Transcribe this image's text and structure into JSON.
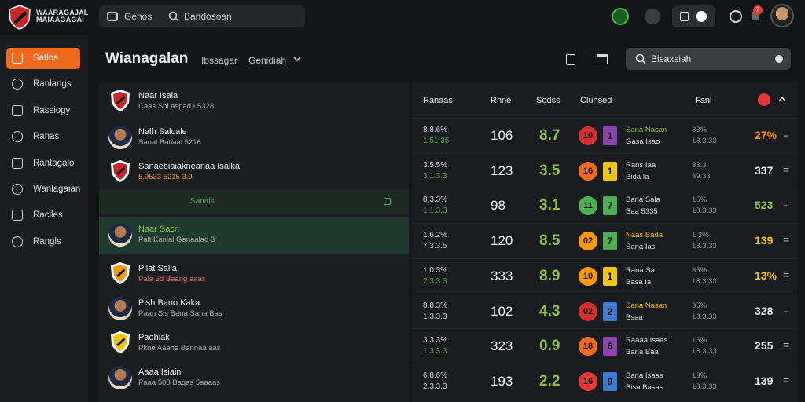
{
  "topbar": {
    "brand_line1": "WAARAGAJAL",
    "brand_line2": "MAIAAGAGAI",
    "search_tab": "Genos",
    "search_placeholder": "Bandosoan",
    "notification_count": "7"
  },
  "sidebar": {
    "items": [
      {
        "label": "Satlos",
        "icon": "home-icon",
        "active": true
      },
      {
        "label": "Ranlangs",
        "icon": "document-icon"
      },
      {
        "label": "Rassiogy",
        "icon": "clock-icon"
      },
      {
        "label": "Ranas",
        "icon": "tablet-icon"
      },
      {
        "label": "Rantagalo",
        "icon": "upload-icon"
      },
      {
        "label": "Wanlagaian",
        "icon": "tag-icon"
      },
      {
        "label": "Raciles",
        "icon": "share-icon"
      },
      {
        "label": "Rangls",
        "icon": "pen-icon"
      }
    ]
  },
  "header": {
    "title": "Wianagalan",
    "crumb1": "Ibssagar",
    "crumb2": "Genidiah",
    "search_placeholder": "Bisaxsiah"
  },
  "left_rows": [
    {
      "type": "shield",
      "name": "Naar Isaia",
      "sub": "Caas Sbi aspad I 5328"
    },
    {
      "type": "person",
      "name": "Nalh Salcale",
      "sub": "Sanal Batiaal 5216"
    },
    {
      "type": "shield",
      "name": "Sanaebiaiakneanaa Isalka",
      "sub": "5.9533  5215  3.9"
    },
    {
      "type": "section",
      "name": "Sanais",
      "sub": ""
    },
    {
      "type": "person",
      "name": "Naar Sacn",
      "sub": "Palt Kanlal Ganaalad 3",
      "highlight": true
    },
    {
      "type": "shield",
      "name": "Pilat Salia",
      "sub": "Pala 5d  Baang aaas"
    },
    {
      "type": "person",
      "name": "Pish Bano Kaka",
      "sub": "Paan Sis Bana Sana Bas"
    },
    {
      "type": "shield",
      "name": "Paohiak",
      "sub": "Pkne Aaahe Bannaa aas"
    },
    {
      "type": "person",
      "name": "Aaaa Isiain",
      "sub": "Paaa 500 Bagas 5aaaas"
    }
  ],
  "table": {
    "headers": [
      "Ranaas",
      "Rnne",
      "Sodss",
      "Clunsed",
      "Fanl"
    ],
    "rows": [
      {
        "a": "8.8.6%",
        "b": "1.51.35",
        "bc": "#4caf50",
        "n1": "106",
        "n2": "8.7",
        "n2c": "#8bc34a",
        "cir": "10",
        "circ": "#d32f2f",
        "sq": "1",
        "sqc": "#8e44ad",
        "m1": "Sana Nasan",
        "m1c": "#8bc34a",
        "m2": "Gasa Isao",
        "pc": "33%",
        "pc2": "18.3.33",
        "sc": "27%",
        "scc": "#ff9800"
      },
      {
        "a": "3.5.5%",
        "b": "3.1.3.3",
        "bc": "#4caf50",
        "n1": "123",
        "n2": "3.5",
        "n2c": "#8bc34a",
        "cir": "16",
        "circ": "#ef6a1f",
        "sq": "1",
        "sqc": "#f1c40f",
        "m1": "Rans Iaa",
        "m1c": "#ddd",
        "m2": "Bida Ia",
        "pc": "33.3",
        "pc2": "39.33",
        "sc": "337",
        "scc": "#e6e6e6"
      },
      {
        "a": "8.3.3%",
        "b": "1.1.3.3",
        "bc": "#4caf50",
        "n1": "98",
        "n2": "3.1",
        "n2c": "#8bc34a",
        "cir": "11",
        "circ": "#4caf50",
        "sq": "7",
        "sqc": "#4caf50",
        "m1": "Bana Sala",
        "m1c": "#ddd",
        "m2": "Baa 5335",
        "pc": "15%",
        "pc2": "18.3.33",
        "sc": "523",
        "scc": "#8bc34a"
      },
      {
        "a": "1.6.2%",
        "b": "7.3.3.5",
        "bc": "#ccc",
        "n1": "120",
        "n2": "8.5",
        "n2c": "#8bc34a",
        "cir": "02",
        "circ": "#ff9800",
        "sq": "7",
        "sqc": "#4caf50",
        "m1": "Naas Bada",
        "m1c": "#f1c40f",
        "m2": "Sana Ias",
        "pc": "1.3%",
        "pc2": "18.3.33",
        "sc": "139",
        "scc": "#f1c40f"
      },
      {
        "a": "1.0.3%",
        "b": "2.3.3.3",
        "bc": "#4caf50",
        "n1": "333",
        "n2": "8.9",
        "n2c": "#8bc34a",
        "cir": "10",
        "circ": "#ff9800",
        "sq": "1",
        "sqc": "#f1c40f",
        "m1": "Rana Sa",
        "m1c": "#ddd",
        "m2": "Basa Ia",
        "pc": "35%",
        "pc2": "18.3.33",
        "sc": "13%",
        "scc": "#f1c40f"
      },
      {
        "a": "8.8.3%",
        "b": "1.3.3.3",
        "bc": "#ccc",
        "n1": "102",
        "n2": "4.3",
        "n2c": "#8bc34a",
        "cir": "02",
        "circ": "#d32f2f",
        "sq": "2",
        "sqc": "#3a7bd5",
        "m1": "Sana Nasan",
        "m1c": "#f1c40f",
        "m2": "Bsaa",
        "pc": "35%",
        "pc2": "18.3.33",
        "sc": "328",
        "scc": "#e6e6e6"
      },
      {
        "a": "3.3.3%",
        "b": "1.3.3.3",
        "bc": "#4caf50",
        "n1": "323",
        "n2": "0.9",
        "n2c": "#8bc34a",
        "cir": "18",
        "circ": "#ef6a1f",
        "sq": "6",
        "sqc": "#8e44ad",
        "m1": "Raaaa Isaas",
        "m1c": "#ddd",
        "m2": "Bana Baa",
        "pc": "15%",
        "pc2": "18.3.33",
        "sc": "255",
        "scc": "#e6e6e6"
      },
      {
        "a": "6.8.6%",
        "b": "2.3.3.3",
        "bc": "#ccc",
        "n1": "193",
        "n2": "2.2",
        "n2c": "#8bc34a",
        "cir": "16",
        "circ": "#e53935",
        "sq": "9",
        "sqc": "#3a7bd5",
        "m1": "Bana Isaas",
        "m1c": "#ddd",
        "m2": "Bisa Basas",
        "pc": "13%",
        "pc2": "18.3.33",
        "sc": "139",
        "scc": "#e6e6e6"
      }
    ]
  },
  "colors": {
    "accent": "#ef6a1f",
    "panel": "#1c1d20",
    "highlight_row": "#1f3a2e"
  }
}
